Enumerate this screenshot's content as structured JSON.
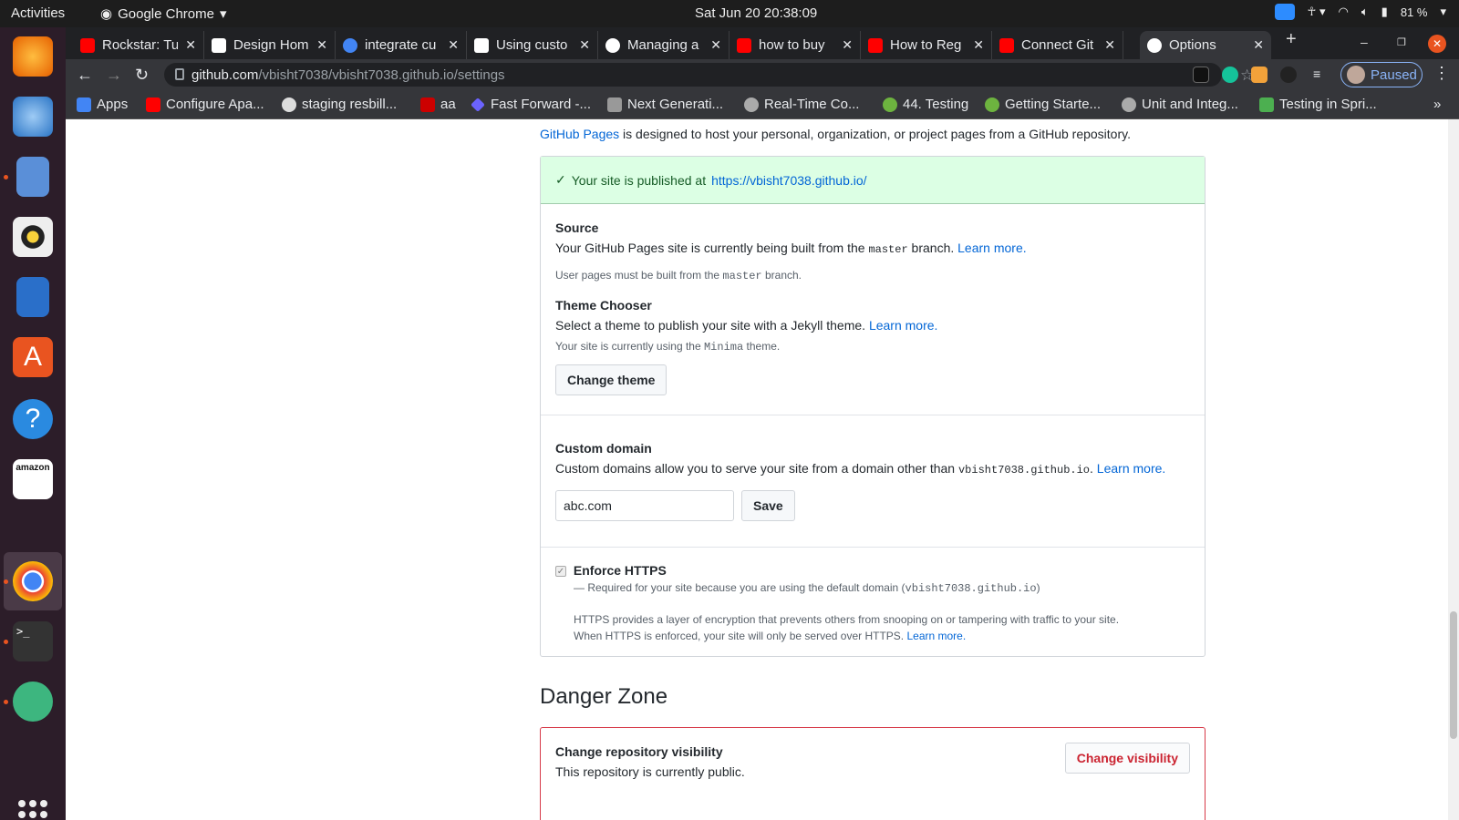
{
  "system": {
    "activities": "Activities",
    "app_name": "Google Chrome",
    "clock": "Sat Jun 20  20:38:09",
    "battery": "81 %"
  },
  "tabs": [
    {
      "title": "Rockstar: Tu",
      "color": "#ff0000"
    },
    {
      "title": "Design Hom",
      "color": "#ffffff"
    },
    {
      "title": "integrate cu",
      "color": "#4285f4"
    },
    {
      "title": "Using custo",
      "color": "#ffffff"
    },
    {
      "title": "Managing a",
      "color": "#ffffff"
    },
    {
      "title": "how to buy",
      "color": "#ff0000"
    },
    {
      "title": "How to Reg",
      "color": "#ff0000"
    },
    {
      "title": "Connect Git",
      "color": "#ff0000"
    },
    {
      "title": "Options",
      "color": "#ffffff"
    }
  ],
  "toolbar": {
    "url_domain": "github.com",
    "url_path": "/vbisht7038/vbisht7038.github.io/settings",
    "profile_label": "Paused"
  },
  "bookmarks": [
    {
      "label": "Apps",
      "color": "#4285f4"
    },
    {
      "label": "Configure Apa...",
      "color": "#ff0000"
    },
    {
      "label": "staging resbill...",
      "color": "#dddddd"
    },
    {
      "label": "aa",
      "color": "#cc0000"
    },
    {
      "label": "Fast Forward -...",
      "color": "#6b63ff"
    },
    {
      "label": "Next Generati...",
      "color": "#999999"
    },
    {
      "label": "Real-Time Co...",
      "color": "#aaaaaa"
    },
    {
      "label": "44. Testing",
      "color": "#6db33f"
    },
    {
      "label": "Getting Starte...",
      "color": "#6db33f"
    },
    {
      "label": "Unit and Integ...",
      "color": "#aaaaaa"
    },
    {
      "label": "Testing in Spri...",
      "color": "#4caf50"
    }
  ],
  "pages": {
    "intro_link": "GitHub Pages",
    "intro_text": " is designed to host your personal, organization, or project pages from a GitHub repository.",
    "published_text": "Your site is published at ",
    "published_url": "https://vbisht7038.github.io/",
    "source_title": "Source",
    "source_text": "Your GitHub Pages site is currently being built from the ",
    "source_branch": "master",
    "source_after": " branch. ",
    "learn_more": "Learn more.",
    "source_note_pre": "User pages must be built from the ",
    "source_note_after": " branch.",
    "theme_title": "Theme Chooser",
    "theme_text": "Select a theme to publish your site with a Jekyll theme. ",
    "theme_note_pre": "Your site is currently using the ",
    "theme_name": "Minima",
    "theme_note_after": " theme.",
    "change_theme": "Change theme",
    "domain_title": "Custom domain",
    "domain_text": "Custom domains allow you to serve your site from a domain other than ",
    "domain_default": "vbisht7038.github.io",
    "domain_value": "abc.com",
    "save": "Save",
    "https_title": "Enforce HTTPS",
    "https_required": "— Required for your site because you are using the default domain (",
    "https_required_end": ")",
    "https_desc1": "HTTPS provides a layer of encryption that prevents others from snooping on or tampering with traffic to your site.",
    "https_desc2": "When HTTPS is enforced, your site will only be served over HTTPS. "
  },
  "danger": {
    "title": "Danger Zone",
    "vis_title": "Change repository visibility",
    "vis_text": "This repository is currently public.",
    "vis_button": "Change visibility"
  }
}
